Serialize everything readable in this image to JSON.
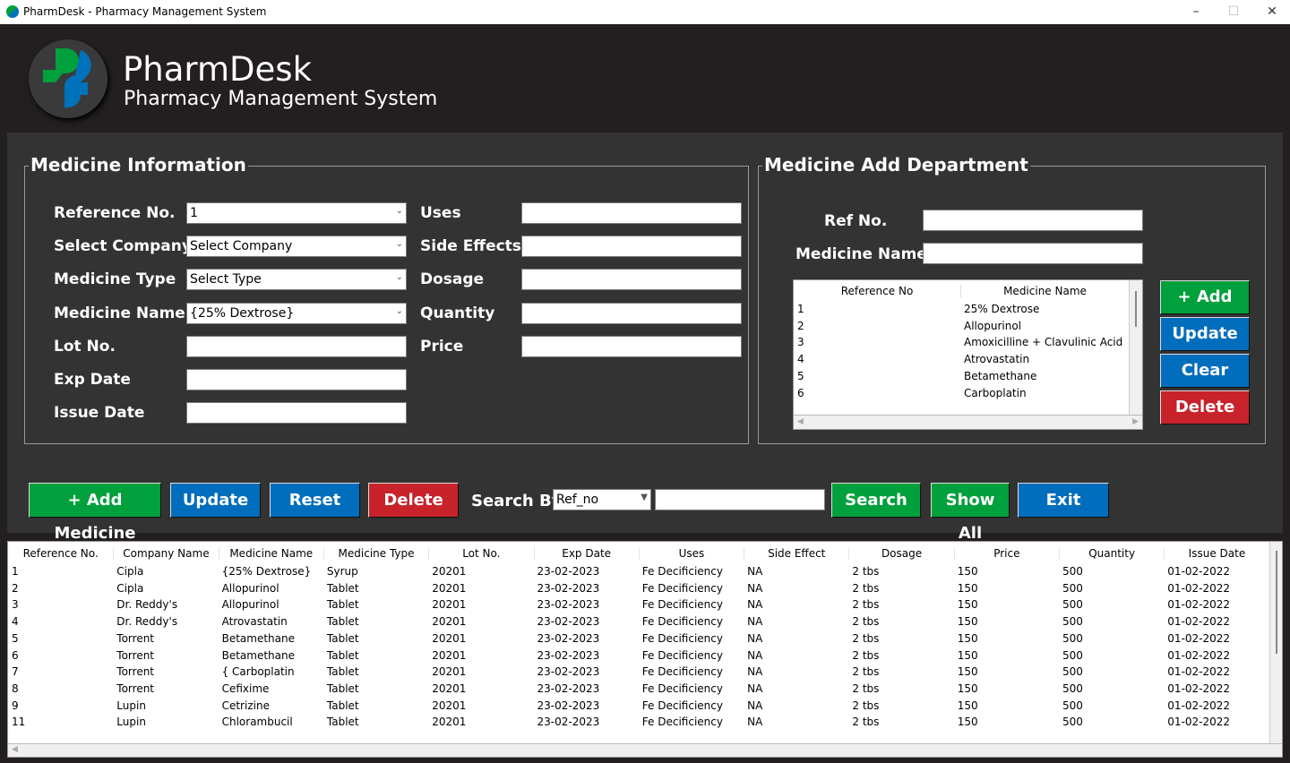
{
  "window": {
    "title": "PharmDesk - Pharmacy Management System",
    "minimize": "–",
    "maximize": "☐",
    "close": "✕"
  },
  "header": {
    "title": "PharmDesk",
    "subtitle": "Pharmacy Management System",
    "colors": {
      "green": "#00a03c",
      "blue": "#0072bc"
    }
  },
  "info": {
    "legend": "Medicine Information",
    "fields": [
      {
        "label": "Reference No.",
        "value": "1",
        "type": "combo"
      },
      {
        "label": "Select Company",
        "value": "Select Company",
        "type": "combo"
      },
      {
        "label": "Medicine Type",
        "value": "Select Type",
        "type": "combo"
      },
      {
        "label": "Medicine Name.",
        "value": "{25% Dextrose}",
        "type": "combo"
      },
      {
        "label": "Lot No.",
        "value": ""
      },
      {
        "label": "Exp Date",
        "value": ""
      },
      {
        "label": "Issue Date",
        "value": ""
      }
    ],
    "fields2": [
      {
        "label": "Uses",
        "value": ""
      },
      {
        "label": "Side Effects",
        "value": ""
      },
      {
        "label": "Dosage",
        "value": ""
      },
      {
        "label": "Quantity",
        "value": ""
      },
      {
        "label": "Price",
        "value": ""
      }
    ]
  },
  "dept": {
    "legend": "Medicine Add Department",
    "ref_label": "Ref No.",
    "name_label": "Medicine Name",
    "columns": [
      "Reference No",
      "Medicine Name"
    ],
    "rows": [
      [
        "1",
        "25% Dextrose"
      ],
      [
        "2",
        "Allopurinol"
      ],
      [
        "3",
        "Amoxicilline + Clavulinic Acid"
      ],
      [
        "4",
        "Atrovastatin"
      ],
      [
        "5",
        "Betamethane"
      ],
      [
        "6",
        " Carboplatin"
      ]
    ],
    "buttons": [
      "+ Add",
      "Update",
      "Clear",
      "Delete"
    ]
  },
  "toolbar": {
    "add": "+ Add Medicine",
    "update": "Update",
    "reset": "Reset",
    "delete": "Delete",
    "search_by": "Search By",
    "search_by_value": "Ref_no",
    "search_value": "",
    "search": "Search",
    "show_all": "Show All",
    "exit": "Exit"
  },
  "table": {
    "columns": [
      "Reference No.",
      "Company Name",
      "Medicine Name",
      "Medicine Type",
      "Lot No.",
      "Exp Date",
      "Uses",
      "Side Effect",
      "Dosage",
      "Price",
      "Quantity",
      "Issue Date"
    ],
    "rows": [
      [
        "1",
        "Cipla",
        "{25% Dextrose}",
        "Syrup",
        "20201",
        "23-02-2023",
        "Fe Decificiency",
        "NA",
        "2 tbs",
        "150",
        "500",
        "01-02-2022"
      ],
      [
        "2",
        "Cipla",
        "Allopurinol",
        "Tablet",
        "20201",
        "23-02-2023",
        "Fe Decificiency",
        "NA",
        "2 tbs",
        "150",
        "500",
        "01-02-2022"
      ],
      [
        "3",
        "Dr. Reddy's",
        "Allopurinol",
        "Tablet",
        "20201",
        "23-02-2023",
        "Fe Decificiency",
        "NA",
        "2 tbs",
        "150",
        "500",
        "01-02-2022"
      ],
      [
        "4",
        "Dr. Reddy's",
        "Atrovastatin",
        "Tablet",
        "20201",
        "23-02-2023",
        "Fe Decificiency",
        "NA",
        "2 tbs",
        "150",
        "500",
        "01-02-2022"
      ],
      [
        "5",
        "Torrent",
        "Betamethane",
        "Tablet",
        "20201",
        "23-02-2023",
        "Fe Decificiency",
        "NA",
        "2 tbs",
        "150",
        "500",
        "01-02-2022"
      ],
      [
        "6",
        "Torrent",
        "Betamethane",
        "Tablet",
        "20201",
        "23-02-2023",
        "Fe Decificiency",
        "NA",
        "2 tbs",
        "150",
        "500",
        "01-02-2022"
      ],
      [
        "7",
        "Torrent",
        "{ Carboplatin",
        "Tablet",
        "20201",
        "23-02-2023",
        "Fe Decificiency",
        "NA",
        "2 tbs",
        "150",
        "500",
        "01-02-2022"
      ],
      [
        "8",
        "Torrent",
        "Cefixime",
        "Tablet",
        "20201",
        "23-02-2023",
        "Fe Decificiency",
        "NA",
        "2 tbs",
        "150",
        "500",
        "01-02-2022"
      ],
      [
        "9",
        "Lupin",
        "Cetrizine",
        "Tablet",
        "20201",
        "23-02-2023",
        "Fe Decificiency",
        "NA",
        "2 tbs",
        "150",
        "500",
        "01-02-2022"
      ],
      [
        "11",
        "Lupin",
        "Chlorambucil",
        "Tablet",
        "20201",
        "23-02-2023",
        "Fe Decificiency",
        "NA",
        "2 tbs",
        "150",
        "500",
        "01-02-2022"
      ]
    ]
  }
}
